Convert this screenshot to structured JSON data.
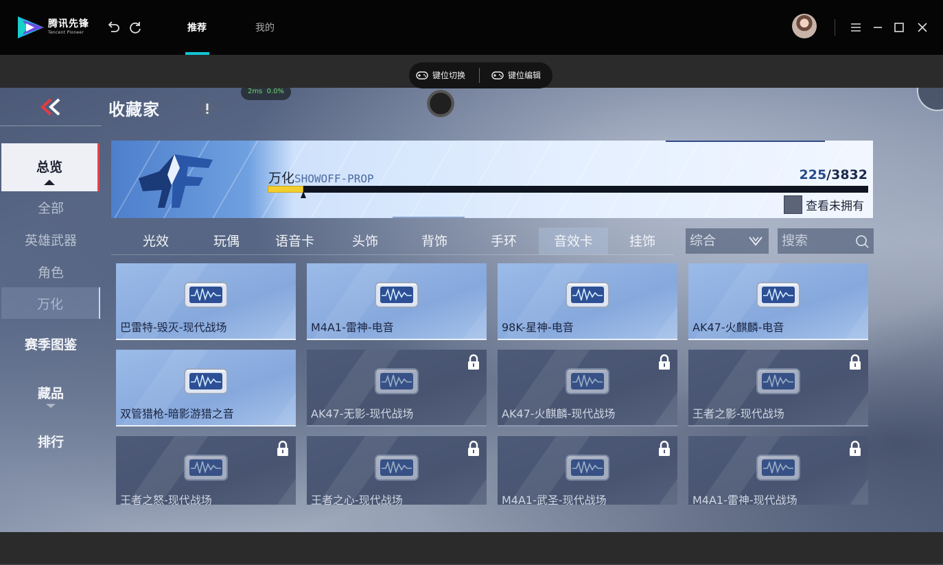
{
  "titlebar": {
    "brand_cn": "腾讯先锋",
    "brand_en": "Tencent Pioneer",
    "tabs": [
      {
        "label": "推荐",
        "active": true
      },
      {
        "label": "我的",
        "active": false
      }
    ],
    "accent_color": "#11c6d4",
    "icons": [
      "undo-icon",
      "refresh-icon",
      "menu-icon",
      "minimize-icon",
      "maximize-icon",
      "close-icon"
    ]
  },
  "keypill": {
    "switch_label": "键位切换",
    "edit_label": "键位编辑"
  },
  "game": {
    "title": "收藏家",
    "ping": "2ms",
    "loss": "0.0%",
    "sidebar": {
      "items": [
        {
          "label": "总览",
          "type": "primary",
          "active": true
        },
        {
          "label": "全部",
          "type": "sub"
        },
        {
          "label": "英雄武器",
          "type": "sub"
        },
        {
          "label": "角色",
          "type": "sub"
        },
        {
          "label": "万化",
          "type": "sub",
          "active": true
        },
        {
          "label": "赛季图鉴",
          "type": "primary"
        },
        {
          "label": "藏品",
          "type": "primary"
        },
        {
          "label": "排行",
          "type": "primary"
        }
      ]
    },
    "banner": {
      "label_cn": "万化",
      "label_en": "SHOWOFF-PROP",
      "owned": "225",
      "total": "/3832",
      "progress_fraction": 0.059,
      "check_unowned_label": "查看未拥有"
    },
    "category_tabs": [
      {
        "label": "光效"
      },
      {
        "label": "玩偶"
      },
      {
        "label": "语音卡"
      },
      {
        "label": "头饰"
      },
      {
        "label": "背饰"
      },
      {
        "label": "手环"
      },
      {
        "label": "音效卡",
        "active": true
      },
      {
        "label": "挂饰"
      }
    ],
    "sort": {
      "value": "综合"
    },
    "search": {
      "placeholder": "搜索"
    },
    "cards": [
      {
        "label": "巴雷特-毁灭-现代战场",
        "owned": true
      },
      {
        "label": "M4A1-雷神-电音",
        "owned": true
      },
      {
        "label": "98K-星神-电音",
        "owned": true
      },
      {
        "label": "AK47-火麒麟-电音",
        "owned": true
      },
      {
        "label": "双管猎枪-暗影游猎之音",
        "owned": true
      },
      {
        "label": "AK47-无影-现代战场",
        "owned": false
      },
      {
        "label": "AK47-火麒麟-现代战场",
        "owned": false
      },
      {
        "label": "王者之影-现代战场",
        "owned": false
      },
      {
        "label": "王者之怒-现代战场",
        "owned": false
      },
      {
        "label": "王者之心-现代战场",
        "owned": false
      },
      {
        "label": "M4A1-武圣-现代战场",
        "owned": false
      },
      {
        "label": "M4A1-雷神-现代战场",
        "owned": false
      }
    ]
  }
}
